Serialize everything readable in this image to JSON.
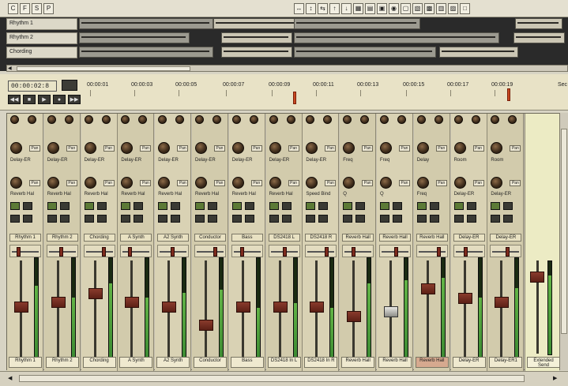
{
  "toolbar": {
    "left_icons": [
      "C",
      "F",
      "S",
      "P"
    ],
    "right_icons": [
      "↔",
      "↕",
      "⇆",
      "↑",
      "↓",
      "▦",
      "▤",
      "▣",
      "◉",
      "▢",
      "▧",
      "▩",
      "▥",
      "▨",
      "□"
    ]
  },
  "tracks": [
    {
      "name": "Rhythm 1"
    },
    {
      "name": "Rhythm 2"
    },
    {
      "name": "Chording"
    }
  ],
  "timeline": {
    "time": "00:00:02:8",
    "ruler": [
      "00:00:01",
      "00:00:03",
      "00:00:05",
      "00:00:07",
      "00:00:09",
      "00:00:11",
      "00:00:13",
      "00:00:15",
      "00:00:17",
      "00:00:19",
      "Sec"
    ]
  },
  "mixer": {
    "strips": [
      {
        "name": "Rhythm 1",
        "fx1": "Delay-ER",
        "fx2": "Reverb Hal",
        "pan": "Pan",
        "bottom": "Rhythm 1",
        "meter": 0.72,
        "fader": 0.55
      },
      {
        "name": "Rhythm 2",
        "fx1": "Delay-ER",
        "fx2": "Reverb Hal",
        "pan": "Pan",
        "bottom": "Rhythm 2",
        "meter": 0.6,
        "fader": 0.6
      },
      {
        "name": "Chording",
        "fx1": "Delay-ER",
        "fx2": "Reverb Hal",
        "pan": "Pan",
        "bottom": "Chording",
        "meter": 0.75,
        "fader": 0.7
      },
      {
        "name": "A Synth",
        "fx1": "Delay-ER",
        "fx2": "Reverb Hal",
        "pan": "Pan",
        "bottom": "A Synth",
        "meter": 0.6,
        "fader": 0.6
      },
      {
        "name": "A2 Synth",
        "fx1": "Delay-ER",
        "fx2": "Reverb Hal",
        "pan": "Pan",
        "bottom": "A2 Synth",
        "meter": 0.65,
        "fader": 0.55
      },
      {
        "name": "Conductor",
        "fx1": "Delay-ER",
        "fx2": "Reverb Hal",
        "pan": "Pan",
        "bottom": "Conductor",
        "meter": 0.68,
        "fader": 0.35
      },
      {
        "name": "Bass",
        "fx1": "Delay-ER",
        "fx2": "Reverb Hal",
        "pan": "Pan",
        "bottom": "Bass",
        "meter": 0.5,
        "fader": 0.55
      },
      {
        "name": "DS2418 L",
        "fx1": "Delay-ER",
        "fx2": "Reverb Hal",
        "pan": "Pan",
        "bottom": "DS2418 In L",
        "meter": 0.55,
        "fader": 0.55
      },
      {
        "name": "DS2418 R",
        "fx1": "Delay-ER",
        "fx2": "Speed Bind",
        "pan": "Pan",
        "bottom": "DS2418 In R",
        "meter": 0.5,
        "fader": 0.55
      },
      {
        "name": "Reverb Hall",
        "fx1": "Freq",
        "fx2": "Q",
        "pan": "Pan",
        "bottom": "Reverb Hall",
        "meter": 0.75,
        "fader": 0.45
      },
      {
        "name": "Reverb Hall",
        "fx1": "Freq",
        "fx2": "Q",
        "pan": "Pan",
        "bottom": "Reverb Hall",
        "meter": 0.78,
        "fader": 0.5
      },
      {
        "name": "Reverb Hall",
        "fx1": "Delay",
        "fx2": "Freq",
        "pan": "Pan",
        "bottom": "Reverb Hall",
        "meter": 0.8,
        "fader": 0.75
      },
      {
        "name": "Delay-ER",
        "fx1": "Room",
        "fx2": "Delay-ER",
        "pan": "Pan",
        "bottom": "Delay-ER",
        "meter": 0.6,
        "fader": 0.65
      },
      {
        "name": "Delay-ER",
        "fx1": "Room",
        "fx2": "Delay-ER",
        "pan": "Pan",
        "bottom": "Delay-ER1",
        "meter": 0.7,
        "fader": 0.6
      }
    ],
    "master": {
      "bottom": "Extended Send",
      "meter": 0.85
    }
  }
}
